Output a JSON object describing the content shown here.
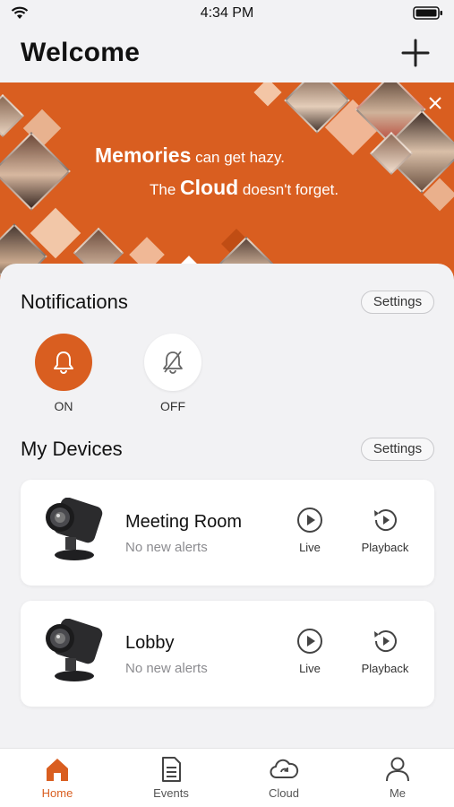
{
  "status_bar": {
    "time": "4:34 PM"
  },
  "header": {
    "title": "Welcome"
  },
  "banner": {
    "line1_big": "Memories",
    "line1_rest": " can get hazy.",
    "line2_pre": "The ",
    "line2_big": "Cloud",
    "line2_rest": " doesn't forget.",
    "accent_color": "#d95e20"
  },
  "notifications": {
    "title": "Notifications",
    "settings_label": "Settings",
    "on_label": "ON",
    "off_label": "OFF",
    "selected": "ON"
  },
  "devices": {
    "title": "My Devices",
    "settings_label": "Settings",
    "items": [
      {
        "name": "Meeting Room",
        "status": "No new alerts",
        "live_label": "Live",
        "playback_label": "Playback"
      },
      {
        "name": "Lobby",
        "status": "No new alerts",
        "live_label": "Live",
        "playback_label": "Playback"
      }
    ]
  },
  "tabbar": {
    "tabs": [
      {
        "label": "Home",
        "icon": "home-icon",
        "active": true
      },
      {
        "label": "Events",
        "icon": "document-icon",
        "active": false
      },
      {
        "label": "Cloud",
        "icon": "cloud-icon",
        "active": false
      },
      {
        "label": "Me",
        "icon": "user-icon",
        "active": false
      }
    ]
  }
}
